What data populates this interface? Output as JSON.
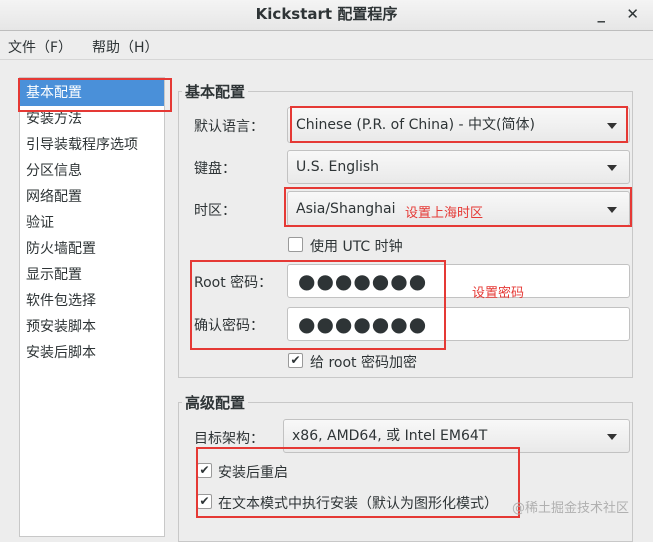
{
  "window": {
    "title": "Kickstart 配置程序",
    "minimize": "_",
    "close": "✕"
  },
  "menu": [
    "文件（F）",
    "帮助（H）"
  ],
  "sidebar": [
    "基本配置",
    "安装方法",
    "引导装载程序选项",
    "分区信息",
    "网络配置",
    "验证",
    "防火墙配置",
    "显示配置",
    "软件包选择",
    "预安装脚本",
    "安装后脚本"
  ],
  "basic": {
    "title": "基本配置",
    "lang_label": "默认语言：",
    "lang_value": "Chinese (P.R. of China) - 中文(简体)",
    "kbd_label": "键盘：",
    "kbd_value": "U.S. English",
    "tz_label": "时区：",
    "tz_value": "Asia/Shanghai",
    "utc_label": "使用  UTC 时钟",
    "utc_checked": false,
    "root_label": "Root 密码：",
    "root_value": "●●●●●●●",
    "confirm_label": "确认密码：",
    "confirm_value": "●●●●●●●",
    "encrypt_label": "给  root 密码加密",
    "encrypt_checked": true
  },
  "advanced": {
    "title": "高级配置",
    "arch_label": "目标架构：",
    "arch_value": "x86, AMD64, 或  Intel EM64T",
    "reboot_label": "安装后重启",
    "reboot_checked": true,
    "text_label": "在文本模式中执行安装（默认为图形化模式）",
    "text_checked": true
  },
  "annotations": {
    "tz_note": "设置上海时区",
    "pwd_note": "设置密码",
    "color": "#e53935"
  },
  "watermark": "@稀土掘金技术社区"
}
